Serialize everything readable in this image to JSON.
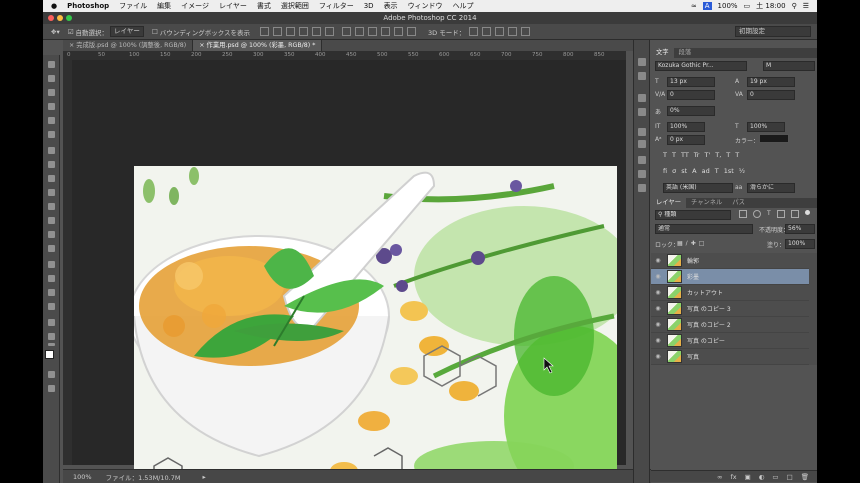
{
  "menubar": {
    "apple": "",
    "app_name": "Photoshop",
    "items": [
      "ファイル",
      "編集",
      "イメージ",
      "レイヤー",
      "書式",
      "選択範囲",
      "フィルター",
      "3D",
      "表示",
      "ウィンドウ",
      "ヘルプ"
    ],
    "status": {
      "battery": "100%",
      "ime": "A",
      "time": "土 18:00"
    }
  },
  "titlebar": {
    "title": "Adobe Photoshop CC 2014"
  },
  "options": {
    "auto_select_label": "自動選択：",
    "auto_select_value": "レイヤー",
    "bbox_label": "バウンディングボックスを表示",
    "mode3d": "3D モード：",
    "preset": "初期設定"
  },
  "tabs": [
    {
      "label": "完成版.psd @ 100% (調整後, RGB/8)",
      "active": false
    },
    {
      "label": "作業用.psd @ 100% (彩墨, RGB/8) *",
      "active": true
    }
  ],
  "ruler": {
    "ticks": [
      "0",
      "50",
      "100",
      "150",
      "200",
      "250",
      "300",
      "350",
      "400",
      "450",
      "500",
      "550",
      "600",
      "650",
      "700",
      "750",
      "800",
      "850"
    ]
  },
  "statusbar": {
    "zoom": "100%",
    "file_info": "ファイル：1.53M/10.7M"
  },
  "character_panel": {
    "tabs": [
      "文字",
      "段落"
    ],
    "font_family": "Kozuka Gothic Pr...",
    "font_style": "M",
    "font_size": "13 px",
    "leading": "19 px",
    "kerning": "0",
    "tracking": "0",
    "vscale_pct": "0%",
    "scale_v": "100%",
    "scale_h": "100%",
    "baseline": "0 px",
    "color_label": "カラー：",
    "language": "英語 (米国)",
    "aa": "滑らかに",
    "style_buttons": [
      "T",
      "T",
      "TT",
      "Tr",
      "T'",
      "T,",
      "T",
      "T"
    ],
    "ot_buttons": [
      "fi",
      "σ",
      "st",
      "A",
      "ad",
      "T",
      "1st",
      "½"
    ]
  },
  "layers_panel": {
    "tabs": [
      "レイヤー",
      "チャンネル",
      "パス"
    ],
    "filter": "種類",
    "blend_mode": "通常",
    "opacity_label": "不透明度：",
    "opacity": "56%",
    "lock_label": "ロック：",
    "fill_label": "塗り：",
    "fill": "100%",
    "layers": [
      {
        "name": "輪郭",
        "selected": false
      },
      {
        "name": "彩墨",
        "selected": true
      },
      {
        "name": "カットアウト",
        "selected": false
      },
      {
        "name": "写真 のコピー 3",
        "selected": false
      },
      {
        "name": "写真 のコピー 2",
        "selected": false
      },
      {
        "name": "写真 のコピー",
        "selected": false
      },
      {
        "name": "写真",
        "selected": false
      }
    ],
    "footer_icons": [
      "link-icon",
      "fx-icon",
      "mask-icon",
      "adjustment-icon",
      "folder-icon",
      "new-layer-icon",
      "trash-icon"
    ]
  },
  "colors": {
    "selected_layer": "#7a8ea8",
    "panel_bg": "#535353",
    "canvas_bg": "#282828"
  }
}
